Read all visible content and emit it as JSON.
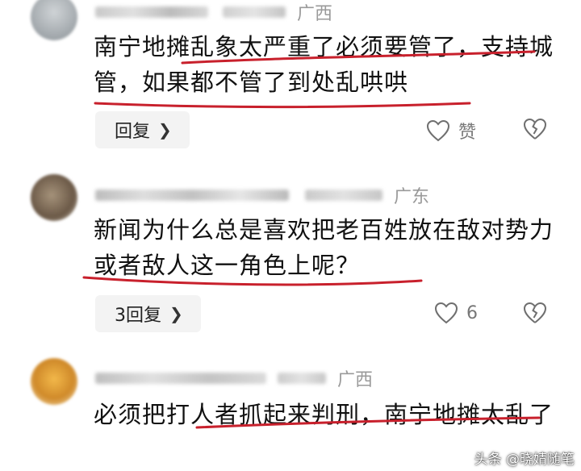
{
  "comments": [
    {
      "region": "广西",
      "text": "南宁地摊乱象太严重了必须要管了，支持城管，如果都不管了到处乱哄哄",
      "reply_label": "回复",
      "like_label": "赞"
    },
    {
      "region": "广东",
      "text": "新闻为什么总是喜欢把老百姓放在敌对势力或者敌人这一角色上呢？",
      "reply_label": "3回复",
      "like_label": "6"
    },
    {
      "region": "广西",
      "text": "必须把打人者抓起来判刑，南宁地摊太乱了"
    }
  ],
  "watermark": "头条 @晓婧随笔",
  "icons": {
    "like": "heart-outline-icon",
    "dislike": "broken-heart-icon",
    "chevron": "chevron-right-icon"
  },
  "colors": {
    "underline": "#c8202c",
    "region": "#9a9a9a",
    "reply_bg": "#f3f3f3"
  }
}
